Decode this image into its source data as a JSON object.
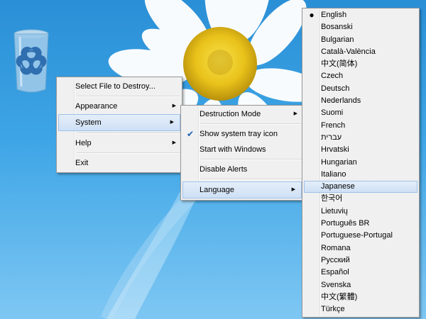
{
  "desktop": {
    "icon_name": "biohazard-recycle-bin-icon"
  },
  "main_menu": {
    "items": [
      {
        "label": "Select File to Destroy..."
      },
      {
        "label": "Appearance"
      },
      {
        "label": "System"
      },
      {
        "label": "Help"
      },
      {
        "label": "Exit"
      }
    ]
  },
  "system_menu": {
    "items": [
      {
        "label": "Destruction Mode"
      },
      {
        "label": "Show system tray icon",
        "checked": true
      },
      {
        "label": "Start with Windows"
      },
      {
        "label": "Disable Alerts"
      },
      {
        "label": "Language"
      }
    ]
  },
  "language_menu": {
    "selected": "English",
    "highlighted": "Japanese",
    "items": [
      {
        "label": "English"
      },
      {
        "label": "Bosanski"
      },
      {
        "label": "Bulgarian"
      },
      {
        "label": "Català-València"
      },
      {
        "label": "中文(简体)"
      },
      {
        "label": "Czech"
      },
      {
        "label": "Deutsch"
      },
      {
        "label": "Nederlands"
      },
      {
        "label": "Suomi"
      },
      {
        "label": "French"
      },
      {
        "label": "עברית"
      },
      {
        "label": "Hrvatski"
      },
      {
        "label": "Hungarian"
      },
      {
        "label": "Italiano"
      },
      {
        "label": "Japanese"
      },
      {
        "label": "한국어"
      },
      {
        "label": "Lietuvių"
      },
      {
        "label": "Português BR"
      },
      {
        "label": "Portuguese-Portugal"
      },
      {
        "label": "Romana"
      },
      {
        "label": "Русский"
      },
      {
        "label": "Español"
      },
      {
        "label": "Svenska"
      },
      {
        "label": "中文(繁體)"
      },
      {
        "label": "Türkçe"
      }
    ]
  },
  "colors": {
    "menu_bg": "#f0f0f0",
    "highlight_border": "#9ec2ea",
    "desktop_blue": "#2a8fd6"
  }
}
